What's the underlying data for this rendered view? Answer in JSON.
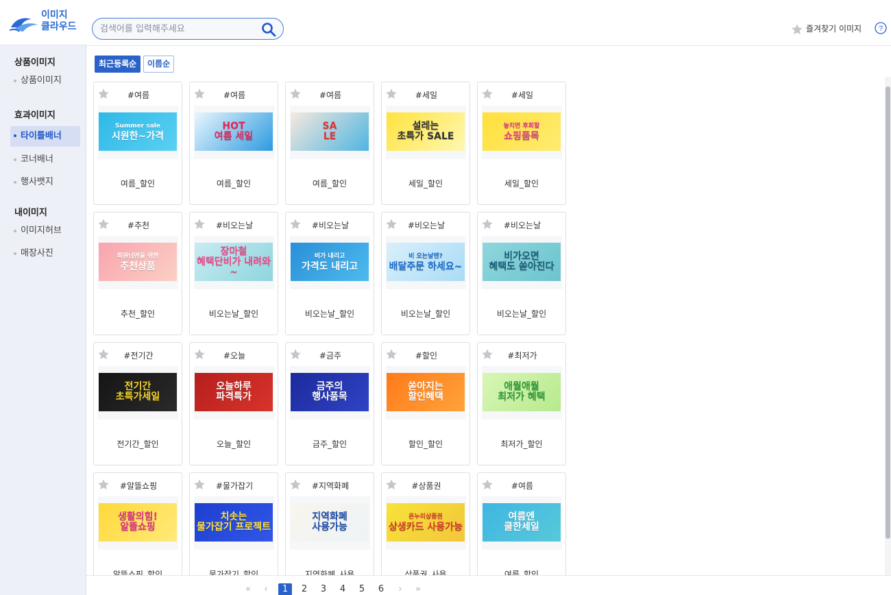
{
  "app": {
    "logo_line1": "이미지",
    "logo_line2": "클라우드"
  },
  "sidebar": {
    "groups": [
      {
        "title": "상품이미지",
        "items": [
          "상품이미지"
        ]
      },
      {
        "title": "효과이미지",
        "items": [
          "타이틀배너",
          "코너배너",
          "행사뱃지"
        ]
      },
      {
        "title": "내이미지",
        "items": [
          "이미지허브",
          "매장사진"
        ]
      }
    ],
    "active_item": "타이틀배너"
  },
  "header": {
    "search_placeholder": "검색어를 입력해주세요",
    "favorites_label": "즐겨찾기 이미지",
    "help_icon": "question-circle-icon"
  },
  "sort": {
    "recent_label": "최근등록순",
    "name_label": "이름순",
    "active": "recent"
  },
  "cards": [
    {
      "tag": "#여름",
      "name": "여름_할인",
      "banner": [
        "Summer sale",
        "시원한~가격"
      ],
      "colors": [
        "#2fb9e8",
        "#5ad0f2"
      ],
      "text_color": "#fff"
    },
    {
      "tag": "#여름",
      "name": "여름_할인",
      "banner": [
        "HOT",
        "여름 세일"
      ],
      "colors": [
        "#e9f6fd",
        "#2d9be0"
      ],
      "text_color": "#e9255b"
    },
    {
      "tag": "#여름",
      "name": "여름_할인",
      "banner": [
        "SA",
        "LE"
      ],
      "colors": [
        "#f6e9df",
        "#4fb5e0"
      ],
      "text_color": "#d83a3a"
    },
    {
      "tag": "#세일",
      "name": "세일_할인",
      "banner": [
        "설레는",
        "초특가 SALE"
      ],
      "colors": [
        "#ffe33f",
        "#fff7b0"
      ],
      "text_color": "#333"
    },
    {
      "tag": "#세일",
      "name": "세일_할인",
      "banner": [
        "놓치면 후회할",
        "쇼핑품목"
      ],
      "colors": [
        "#ffe03a",
        "#ffeb72"
      ],
      "text_color": "#e63a8c"
    },
    {
      "tag": "#추천",
      "name": "추천_할인",
      "banner": [
        "회원님만을 위한",
        "추천상품"
      ],
      "colors": [
        "#f8a4ae",
        "#fcd0c4"
      ],
      "text_color": "#fff"
    },
    {
      "tag": "#비오는날",
      "name": "비오는날_할인",
      "banner": [
        "장마철",
        "혜택단비가 내려와~"
      ],
      "colors": [
        "#c9ebf2",
        "#8ed5de"
      ],
      "text_color": "#e94d8b"
    },
    {
      "tag": "#비오는날",
      "name": "비오는날_할인",
      "banner": [
        "비가 내리고",
        "가격도 내리고"
      ],
      "colors": [
        "#2a8fd8",
        "#4dbbee"
      ],
      "text_color": "#fff"
    },
    {
      "tag": "#비오는날",
      "name": "비오는날_할인",
      "banner": [
        "비 오는날엔?",
        "배달주문 하세요~"
      ],
      "colors": [
        "#d9effb",
        "#a9dcf6"
      ],
      "text_color": "#1e6fcf"
    },
    {
      "tag": "#비오는날",
      "name": "비오는날_할인",
      "banner": [
        "비가오면",
        "혜택도 쏟아진다"
      ],
      "colors": [
        "#8fd6dc",
        "#6cc4cf"
      ],
      "text_color": "#1c5e7a"
    },
    {
      "tag": "#전기간",
      "name": "전기간_할인",
      "banner": [
        "전기간",
        "초특가세일"
      ],
      "colors": [
        "#151515",
        "#2a2a2a"
      ],
      "text_color": "#f7d42b"
    },
    {
      "tag": "#오늘",
      "name": "오늘_할인",
      "banner": [
        "오늘하루",
        "파격특가"
      ],
      "colors": [
        "#b51e1e",
        "#d8342a"
      ],
      "text_color": "#fff"
    },
    {
      "tag": "#금주",
      "name": "금주_할인",
      "banner": [
        "금주의",
        "행사품목"
      ],
      "colors": [
        "#1c2a9c",
        "#2f43c4"
      ],
      "text_color": "#fff"
    },
    {
      "tag": "#할인",
      "name": "할인_할인",
      "banner": [
        "쏟아지는",
        "할인혜택"
      ],
      "colors": [
        "#ff7a1a",
        "#ffa33a"
      ],
      "text_color": "#fff"
    },
    {
      "tag": "#최저가",
      "name": "최저가_할인",
      "banner": [
        "애월애월",
        "최저가 혜택"
      ],
      "colors": [
        "#d8f6b6",
        "#b7ea8c"
      ],
      "text_color": "#2f9d3a"
    },
    {
      "tag": "#알뜰쇼핑",
      "name": "알뜰쇼핑_할인",
      "banner": [
        "생활의힘!",
        "알뜰쇼핑"
      ],
      "colors": [
        "#ffd93a",
        "#ffe97a"
      ],
      "text_color": "#e0338a"
    },
    {
      "tag": "#물가잡기",
      "name": "물가잡기_할인",
      "banner": [
        "치솟는",
        "물가잡기 프로젝트"
      ],
      "colors": [
        "#1d3fd0",
        "#3157e8"
      ],
      "text_color": "#ffe23a"
    },
    {
      "tag": "#지역화폐",
      "name": "지역화폐_사용",
      "banner": [
        "지역화폐",
        "사용가능"
      ],
      "colors": [
        "#f8f5ec",
        "#eef3f7"
      ],
      "text_color": "#1c4fae"
    },
    {
      "tag": "#상품권",
      "name": "상품권_사용",
      "banner": [
        "온누리상품권",
        "상생카드 사용가능"
      ],
      "colors": [
        "#f7e33a",
        "#f3c63a"
      ],
      "text_color": "#d63a2a"
    },
    {
      "tag": "#여름",
      "name": "여름_할인",
      "banner": [
        "여름엔",
        "쿨한세일"
      ],
      "colors": [
        "#3fb6e2",
        "#57c9d9"
      ],
      "text_color": "#fff"
    }
  ],
  "pagination": {
    "pages": [
      "1",
      "2",
      "3",
      "4",
      "5",
      "6"
    ],
    "current": "1",
    "first": "«",
    "prev": "‹",
    "next": "›",
    "last": "»"
  }
}
